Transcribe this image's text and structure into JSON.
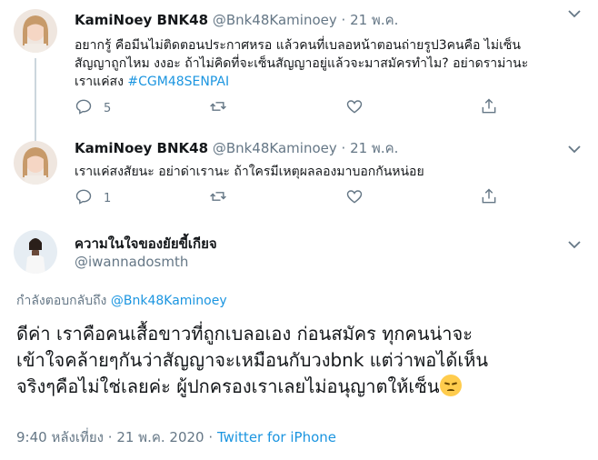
{
  "thread": [
    {
      "name": "KamiNoey BNK48",
      "handle": "@Bnk48Kaminoey",
      "separator": "·",
      "date": "21 พ.ค.",
      "text_lines": [
        "อยากรู้ คือมีนไม่ติดตอนประกาศหรอ แล้วคนที่เบลอหน้าตอนถ่ายรูป3คนคือ ไม่เซ็น",
        "สัญญาถูกไหม งงอะ ถ้าไม่คิดที่จะเซ็นสัญญาอยู่แล้วจะมาสมัครทำไม? อย่าดราม่านะ",
        "เราแค่สง "
      ],
      "hashtag": "#CGM48SENPAI",
      "reply_count": "5"
    },
    {
      "name": "KamiNoey BNK48",
      "handle": "@Bnk48Kaminoey",
      "separator": "·",
      "date": "21 พ.ค.",
      "text_lines": [
        "เราแค่สงสัยนะ อย่าด่าเรานะ ถ้าใครมีเหตุผลลองมาบอกกันหน่อย"
      ],
      "reply_count": "1"
    }
  ],
  "focus_tweet": {
    "name": "ความในใจของยัยขี้เกียจ",
    "handle": "@iwannadosmth",
    "reply_prefix": "กำลังตอบกลับถึง",
    "reply_mention": "@Bnk48Kaminoey",
    "text_lines": [
      "ดีค่า เราคือคนเสื้อขาวที่ถูกเบลอเอง ก่อนสมัคร ทุกคนน่าจะ",
      "เข้าใจคล้ายๆกันว่าสัญญาจะเหมือนกับวงbnk แต่ว่าพอได้เห็น",
      "จริงๆคือไม่ใช่เลยค่ะ ผู้ปกครองเราเลยไม่อนุญาตให้เซ็น"
    ],
    "emoji": "pensive-face",
    "time": "9:40 หลังเที่ยง",
    "separator": "·",
    "date": "21 พ.ค. 2020",
    "source": "Twitter for iPhone"
  },
  "colors": {
    "accent": "#1b95e0",
    "muted": "#657786",
    "text": "#14171a",
    "line": "#ccd6dd"
  },
  "icons": [
    "reply-icon",
    "retweet-icon",
    "like-icon",
    "share-icon",
    "chevron-down-icon"
  ]
}
